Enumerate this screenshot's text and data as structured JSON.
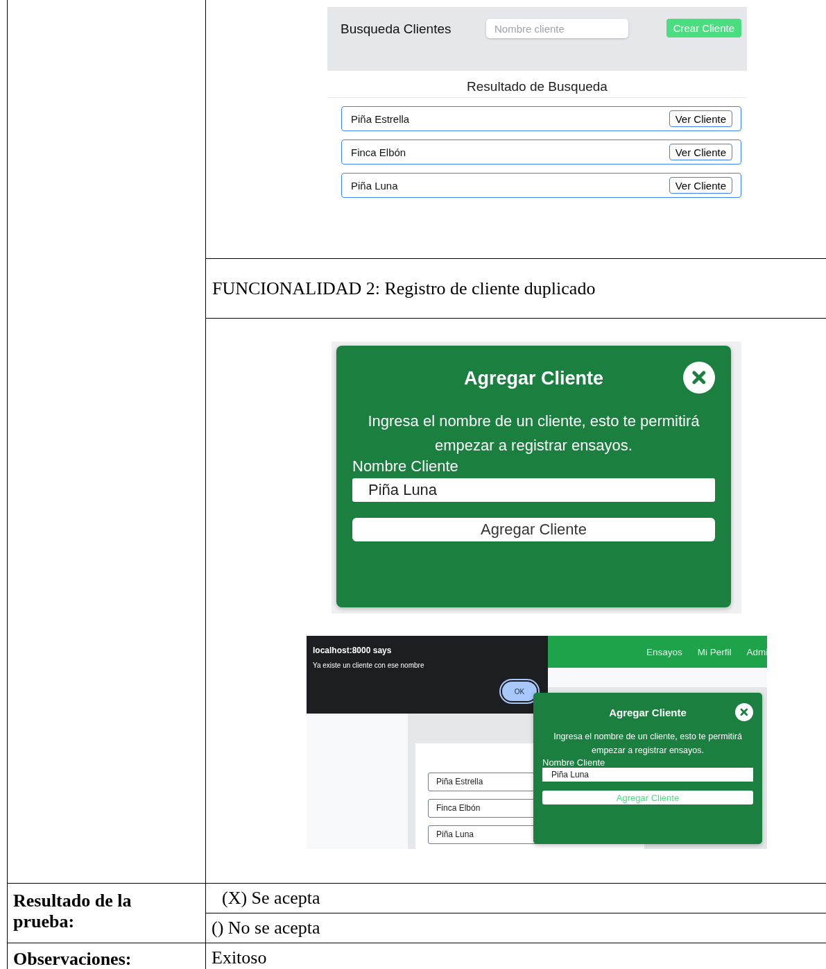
{
  "screenshot_1": {
    "title": "Busqueda Clientes",
    "search": {
      "placeholder": "Nombre cliente"
    },
    "create_button": "Crear Cliente",
    "results_heading": "Resultado de Busqueda",
    "results": [
      {
        "name": "Piña Estrella",
        "button": "Ver Cliente"
      },
      {
        "name": "Finca Elbón",
        "button": "Ver Cliente"
      },
      {
        "name": "Piña Luna",
        "button": "Ver Cliente"
      }
    ]
  },
  "section_heading": "FUNCIONALIDAD 2: Registro de cliente duplicado",
  "screenshot_2": {
    "dialog": {
      "title": "Agregar Cliente",
      "description": "Ingresa el nombre de un cliente, esto te permitirá empezar a registrar ensayos.",
      "field_label": "Nombre Cliente",
      "field_value": "Piña Luna",
      "submit": "Agregar Cliente"
    }
  },
  "screenshot_3": {
    "alert": {
      "title": "localhost:8000 says",
      "message": "Ya existe un cliente con ese nombre",
      "button": "OK"
    },
    "nav": [
      "Ensayos",
      "Mi Perfil",
      "Admi"
    ],
    "results": [
      "Piña Estrella",
      "Finca Elbón",
      "Piña Luna"
    ],
    "dialog": {
      "title": "Agregar Cliente",
      "description": "Ingresa el nombre de un cliente, esto te permitirá empezar a registrar ensayos.",
      "field_label": "Nombre Cliente",
      "field_value": "Piña Luna",
      "submit": "Agregar Cliente"
    }
  },
  "result": {
    "label": "Resultado de la prueba:",
    "options": [
      "(X) Se acepta",
      "() No se acepta"
    ]
  },
  "observations": {
    "label": "Observaciones:",
    "value": "Exitoso"
  }
}
